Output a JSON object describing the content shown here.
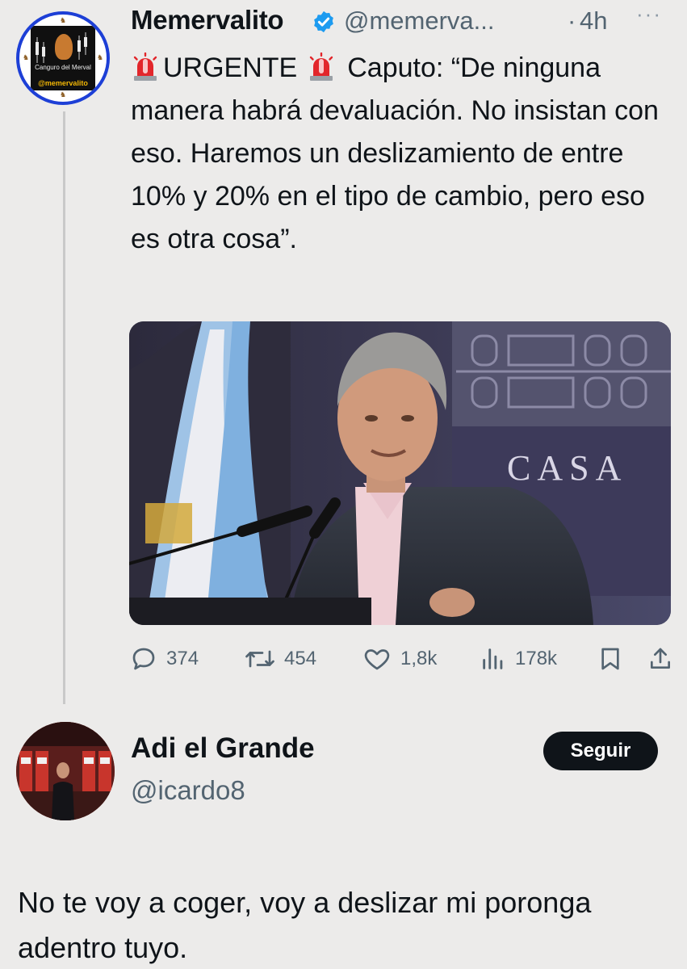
{
  "tweet": {
    "author_name": "Memervalito",
    "handle": "@memerva...",
    "separator": "·",
    "time": "4h",
    "more_label": "···",
    "avatar_text_top": "Canguro del Merval",
    "avatar_text_bottom": "@memervalito",
    "text_parts": {
      "urgent": "URGENTE",
      "body": "Caputo: “De ninguna manera habrá devaluación. No insistan con eso. Haremos un deslizamiento de entre 10% y 20% en el tipo de cambio, pero eso es otra cosa”."
    },
    "media_sign_text": "CASA",
    "actions": {
      "replies": "374",
      "retweets": "454",
      "likes": "1,8k",
      "views": "178k"
    }
  },
  "reply": {
    "author_name": "Adi el Grande",
    "handle": "@icardo8",
    "follow_label": "Seguir",
    "text": "No te voy a coger, voy a deslizar mi poronga adentro tuyo."
  },
  "colors": {
    "background": "#ecebea",
    "text": "#0f1419",
    "secondary": "#536471",
    "verified": "#1d9bf0",
    "avatar_ring": "#1d3fd6"
  }
}
